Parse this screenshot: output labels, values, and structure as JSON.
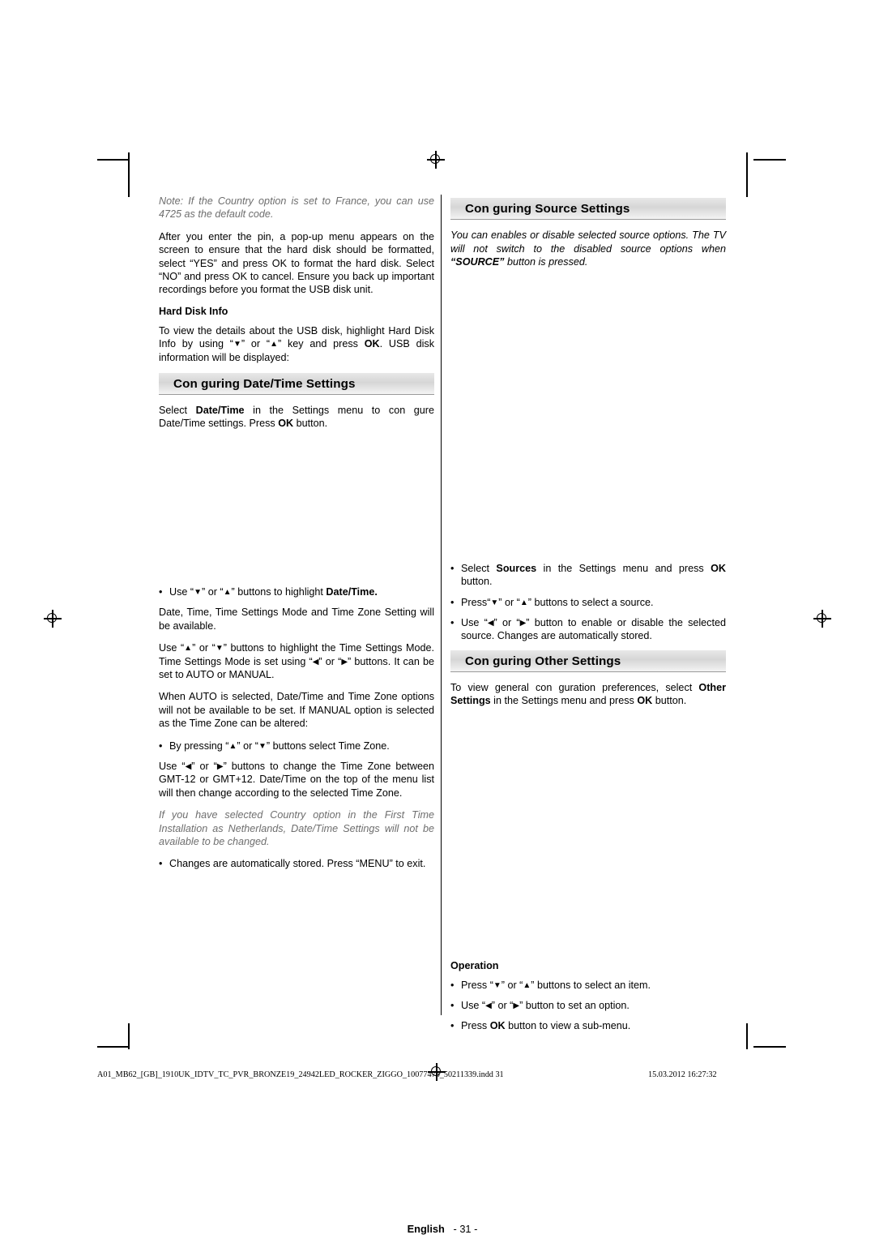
{
  "page": {
    "footer_language": "English",
    "footer_page": "- 31 -",
    "footline_left": "A01_MB62_[GB]_1910UK_IDTV_TC_PVR_BRONZE19_24942LED_ROCKER_ZIGGO_10077476_50211339.indd   31",
    "footline_right": "15.03.2012   16:27:32"
  },
  "left_column": {
    "note": "Note: If the Country option is set to France, you can use 4725 as the default code.",
    "para_pin": "After you enter the pin, a pop-up menu appears on the screen to ensure that the hard disk should be formatted, select “YES” and press OK to format the hard disk. Select “NO” and press OK to cancel. Ensure you back up important recordings before you format the USB disk unit.",
    "hard_disk_info_heading": "Hard Disk Info",
    "para_hard_disk_info": "To view the details about the USB disk, highlight Hard Disk Info by using “▼” or “▲” key and press OK. USB disk information will be displayed:",
    "datetime_heading": "Con guring Date/Time Settings",
    "para_datetime_select": "Select Date/Time in the Settings menu to con gure Date/Time settings. Press OK button.",
    "bullet_highlight": "Use “▼” or “▲” buttons to highlight Date/Time.",
    "para_datetime_avail": "Date, Time, Time Settings Mode and Time Zone Setting will be available.",
    "para_timesettings": "Use “▲” or “▼” buttons to highlight the Time Settings Mode. Time Settings Mode is set using “◀” or “▶” buttons. It can be set to AUTO or MANUAL.",
    "para_auto": "When AUTO is selected, Date/Time and Time Zone options will not be available to be set. If MANUAL option is selected as the Time Zone can be altered:",
    "bullet_timezone": "By pressing “▲” or “▼” buttons select Time Zone.",
    "para_gmt": "Use “◀” or “▶” buttons to change the Time Zone between GMT-12 or GMT+12. Date/Time on the top of the menu list will then change according to the selected Time Zone.",
    "note_netherlands": "If you have selected Country option in the First Time Installation as Netherlands, Date/Time Settings will not be available to be changed.",
    "bullet_stored": "Changes are automatically stored. Press “MENU” to exit."
  },
  "right_column": {
    "source_heading": "Con guring Source Settings",
    "source_italic": "You can enables or disable selected source options. The TV will not switch to the disabled source options when “SOURCE” button is pressed.",
    "bullet_select_sources": "Select Sources in the Settings menu and press OK button.",
    "bullet_press_buttons": "Press“▼” or “▲” buttons to select a source.",
    "bullet_enable_disable": "Use “◀” or “▶” button to enable or disable the selected source. Changes are automatically stored.",
    "other_heading": "Con guring Other Settings",
    "other_body": "To view general con guration preferences, select Other Settings in the Settings menu and press OK button.",
    "operation_heading": "Operation",
    "op_bullet_1": "Press “▼” or “▲” buttons to select an item.",
    "op_bullet_2": "Use “◀” or “▶” button to set an option.",
    "op_bullet_3": "Press OK button to view a sub-menu."
  }
}
